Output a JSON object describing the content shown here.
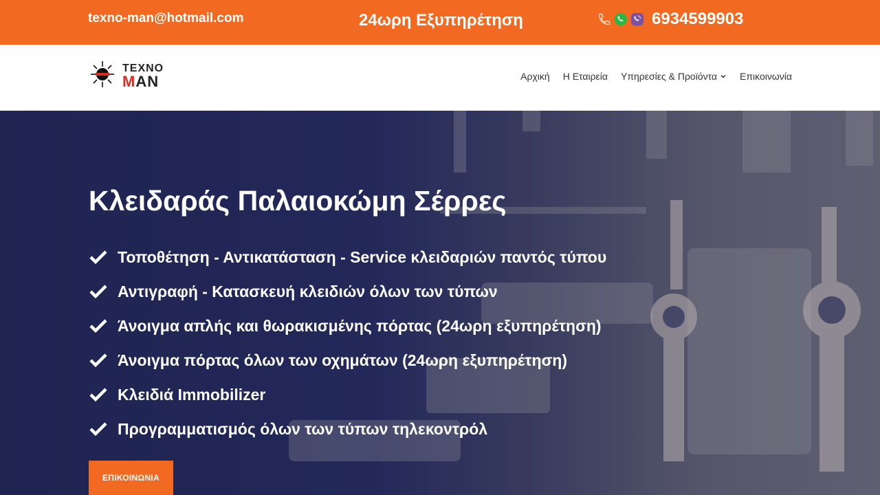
{
  "topbar": {
    "email": "texno-man@hotmail.com",
    "service": "24ωρη Εξυπηρέτηση",
    "phone": "6934599903",
    "icons": [
      "phone-icon",
      "whatsapp-icon",
      "viber-icon"
    ]
  },
  "logo": {
    "line1": "TEXNO",
    "line2_a": "M",
    "line2_b": "AN"
  },
  "nav": {
    "items": [
      "Αρχική",
      "Η Εταιρεία",
      "Υπηρεσίες & Προϊόντα",
      "Επικοινωνία"
    ]
  },
  "hero": {
    "title": "Κλειδαράς Παλαιοκώμη Σέρρες",
    "features": [
      "Τοποθέτηση - Αντικατάσταση - Service κλειδαριών παντός τύπου",
      "Αντιγραφή - Κατασκευή κλειδιών όλων των τύπων",
      "Άνοιγμα απλής και θωρακισμένης πόρτας (24ωρη εξυπηρέτηση)",
      "Άνοιγμα πόρτας όλων των οχημάτων (24ωρη εξυπηρέτηση)",
      "Κλειδιά Immobilizer",
      "Προγραμματισμός όλων των τύπων τηλεκοντρόλ"
    ],
    "cta": "ΕΠΙΚΟΙΝΩΝΙΑ"
  },
  "colors": {
    "accent": "#f26a21",
    "hero_bg": "#232859",
    "logo_red": "#e02b20"
  }
}
